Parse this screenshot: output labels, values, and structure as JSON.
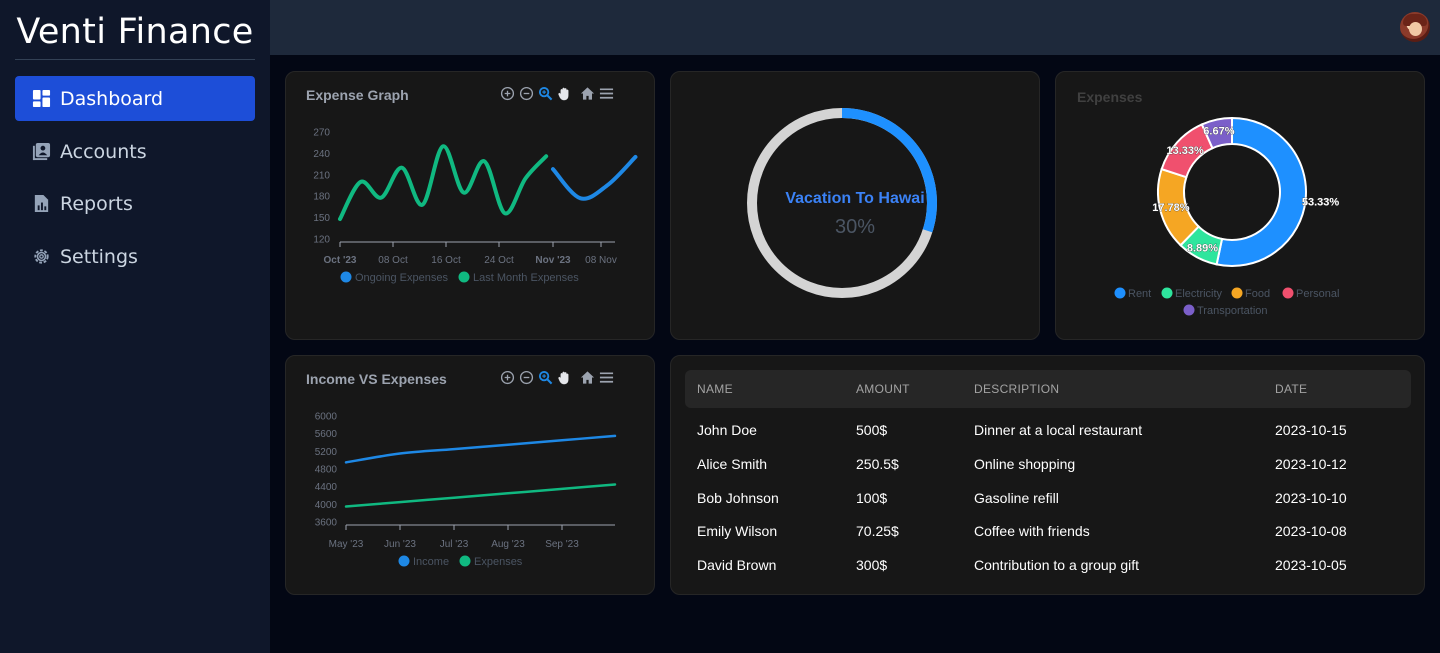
{
  "brand": "Venti Finance",
  "nav": [
    {
      "label": "Dashboard",
      "icon": "dashboard-icon",
      "active": true
    },
    {
      "label": "Accounts",
      "icon": "accounts-icon",
      "active": false
    },
    {
      "label": "Reports",
      "icon": "reports-icon",
      "active": false
    },
    {
      "label": "Settings",
      "icon": "settings-icon",
      "active": false
    }
  ],
  "colors": {
    "accent": "#1d4ed8",
    "series_green": "#10b981",
    "series_blue": "#1e88e5",
    "rent": "#1e90ff",
    "electricity": "#2ee59d",
    "food": "#f5a623",
    "personal": "#f0506e",
    "transportation": "#7b5fc9"
  },
  "expense_graph": {
    "title": "Expense Graph",
    "toolbar": [
      "zoom-in-icon",
      "zoom-out-icon",
      "search-zoom-icon",
      "pan-hand-icon",
      "home-reset-icon",
      "menu-icon"
    ]
  },
  "income_vs_expenses": {
    "title": "Income VS Expenses",
    "toolbar": [
      "zoom-in-icon",
      "zoom-out-icon",
      "search-zoom-icon",
      "pan-hand-icon",
      "home-reset-icon",
      "menu-icon"
    ]
  },
  "goal": {
    "title": "Vacation To Hawai",
    "percent_label": "30%",
    "percent": 30
  },
  "expenses_card": {
    "title": "Expenses"
  },
  "table": {
    "columns": [
      "NAME",
      "AMOUNT",
      "DESCRIPTION",
      "DATE"
    ],
    "rows": [
      [
        "John Doe",
        "500$",
        "Dinner at a local restaurant",
        "2023-10-15"
      ],
      [
        "Alice Smith",
        "250.5$",
        "Online shopping",
        "2023-10-12"
      ],
      [
        "Bob Johnson",
        "100$",
        "Gasoline refill",
        "2023-10-10"
      ],
      [
        "Emily Wilson",
        "70.25$",
        "Coffee with friends",
        "2023-10-08"
      ],
      [
        "David Brown",
        "300$",
        "Contribution to a group gift",
        "2023-10-05"
      ]
    ]
  },
  "chart_data": [
    {
      "type": "line",
      "title": "Expense Graph",
      "x_ticks": [
        "Oct '23",
        "08 Oct",
        "16 Oct",
        "24 Oct",
        "Nov '23",
        "08 Nov"
      ],
      "y_ticks": [
        270,
        240,
        210,
        180,
        150,
        120
      ],
      "ylim": [
        120,
        270
      ],
      "series": [
        {
          "name": "Ongoing Expenses",
          "color": "#1e88e5",
          "x": [
            "2023-11-01",
            "2023-11-05",
            "2023-11-09",
            "2023-11-13"
          ],
          "values": [
            218,
            177,
            196,
            235
          ]
        },
        {
          "name": "Last Month Expenses",
          "color": "#10b981",
          "x": [
            "2023-10-01",
            "2023-10-04",
            "2023-10-07",
            "2023-10-10",
            "2023-10-13",
            "2023-10-16",
            "2023-10-19",
            "2023-10-22",
            "2023-10-25",
            "2023-10-28",
            "2023-10-31"
          ],
          "values": [
            148,
            200,
            178,
            220,
            168,
            250,
            185,
            229,
            156,
            205,
            236
          ]
        }
      ],
      "legend": "bottom",
      "grid": false
    },
    {
      "type": "line",
      "title": "Income VS Expenses",
      "x_ticks": [
        "May '23",
        "Jun '23",
        "Jul '23",
        "Aug '23",
        "Sep '23"
      ],
      "y_ticks": [
        6000,
        5600,
        5200,
        4800,
        4400,
        4000,
        3600
      ],
      "ylim": [
        3600,
        6000
      ],
      "series": [
        {
          "name": "Income",
          "color": "#1e88e5",
          "x": [
            "May '23",
            "Jun '23",
            "Jul '23",
            "Aug '23",
            "Sep '23",
            "Oct '23"
          ],
          "values": [
            4950,
            5150,
            5250,
            5350,
            5450,
            5550
          ]
        },
        {
          "name": "Expenses",
          "color": "#10b981",
          "x": [
            "May '23",
            "Jun '23",
            "Jul '23",
            "Aug '23",
            "Sep '23",
            "Oct '23"
          ],
          "values": [
            3950,
            4050,
            4150,
            4250,
            4350,
            4450
          ]
        }
      ],
      "legend": "bottom",
      "grid": false
    },
    {
      "type": "pie",
      "title": "Expenses",
      "categories": [
        "Rent",
        "Electricity",
        "Food",
        "Personal",
        "Transportation"
      ],
      "values": [
        53.33,
        8.89,
        17.78,
        13.33,
        6.67
      ],
      "labels": [
        "53.33%",
        "8.89%",
        "17.78%",
        "13.33%",
        "6.67%"
      ],
      "colors": [
        "#1e90ff",
        "#2ee59d",
        "#f5a623",
        "#f0506e",
        "#7b5fc9"
      ],
      "legend": "bottom",
      "donut": true
    }
  ]
}
